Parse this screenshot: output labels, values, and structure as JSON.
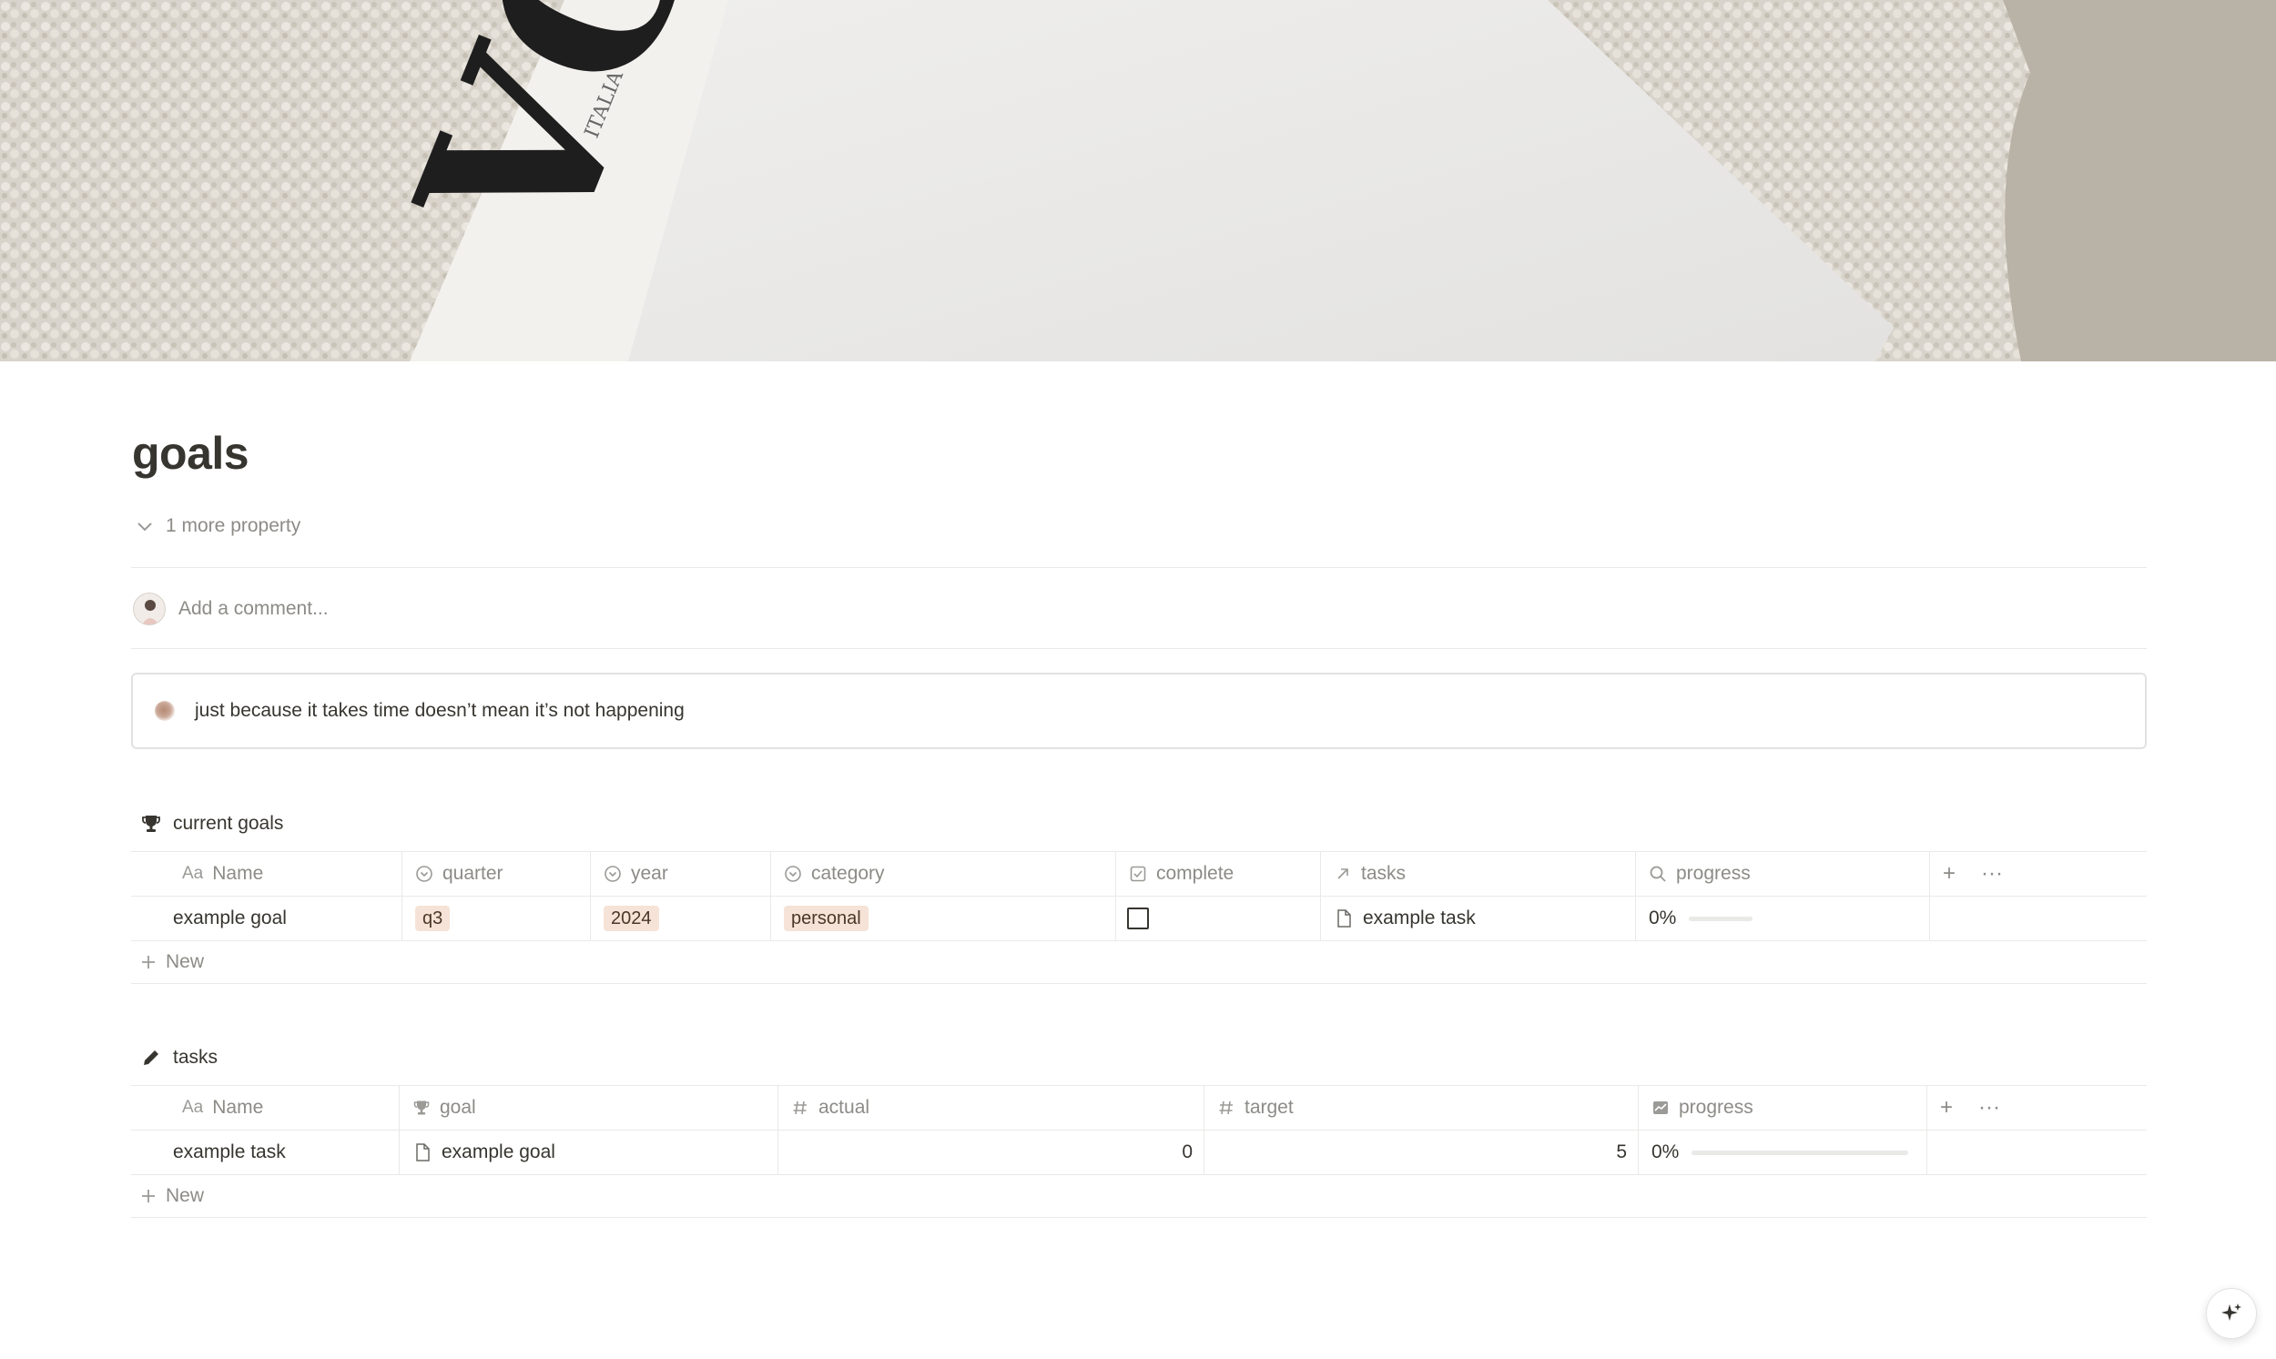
{
  "page": {
    "title": "goals",
    "more_property": "1 more property",
    "comment_placeholder": "Add a comment...",
    "callout_text": "just because it takes time doesn’t mean it’s not happening"
  },
  "cover": {
    "magazine_text": "VO",
    "magazine_subtext": "ITALIA"
  },
  "current_goals": {
    "title": "current goals",
    "icon": "trophy-icon",
    "columns": [
      "Name",
      "quarter",
      "year",
      "category",
      "complete",
      "tasks",
      "progress"
    ],
    "name_prefix": "Aa",
    "rows": [
      {
        "name": "example goal",
        "quarter": "q3",
        "year": "2024",
        "category": "personal",
        "complete": false,
        "tasks": "example task",
        "progress_text": "0%",
        "progress_fraction": 0
      }
    ],
    "new_label": "New",
    "add_column": "+",
    "more": "···"
  },
  "tasks": {
    "title": "tasks",
    "icon": "pencil-icon",
    "columns": [
      "Name",
      "goal",
      "actual",
      "target",
      "progress"
    ],
    "name_prefix": "Aa",
    "rows": [
      {
        "name": "example task",
        "goal": "example goal",
        "actual": "0",
        "target": "5",
        "progress_text": "0%",
        "progress_fraction": 0
      }
    ],
    "new_label": "New",
    "add_column": "+",
    "more": "···"
  },
  "colors": {
    "text": "#37352f",
    "muted": "#8d8b87",
    "tag_bg": "#f6e3d7",
    "border": "#e9e9e7"
  }
}
